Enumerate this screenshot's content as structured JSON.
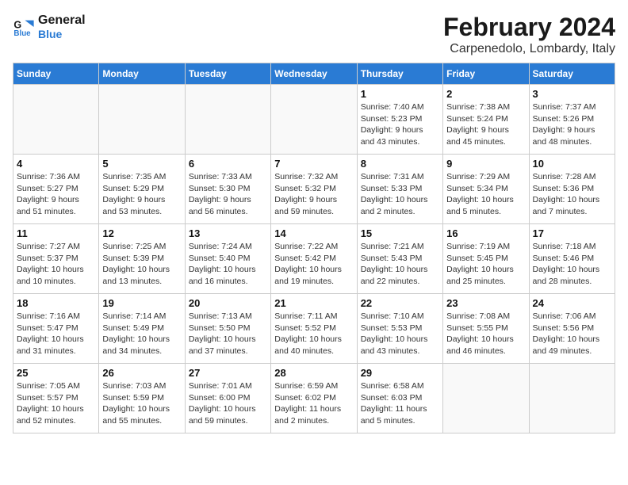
{
  "header": {
    "logo_line1": "General",
    "logo_line2": "Blue",
    "title": "February 2024",
    "subtitle": "Carpenedolo, Lombardy, Italy"
  },
  "weekdays": [
    "Sunday",
    "Monday",
    "Tuesday",
    "Wednesday",
    "Thursday",
    "Friday",
    "Saturday"
  ],
  "weeks": [
    [
      {
        "day": "",
        "info": ""
      },
      {
        "day": "",
        "info": ""
      },
      {
        "day": "",
        "info": ""
      },
      {
        "day": "",
        "info": ""
      },
      {
        "day": "1",
        "info": "Sunrise: 7:40 AM\nSunset: 5:23 PM\nDaylight: 9 hours\nand 43 minutes."
      },
      {
        "day": "2",
        "info": "Sunrise: 7:38 AM\nSunset: 5:24 PM\nDaylight: 9 hours\nand 45 minutes."
      },
      {
        "day": "3",
        "info": "Sunrise: 7:37 AM\nSunset: 5:26 PM\nDaylight: 9 hours\nand 48 minutes."
      }
    ],
    [
      {
        "day": "4",
        "info": "Sunrise: 7:36 AM\nSunset: 5:27 PM\nDaylight: 9 hours\nand 51 minutes."
      },
      {
        "day": "5",
        "info": "Sunrise: 7:35 AM\nSunset: 5:29 PM\nDaylight: 9 hours\nand 53 minutes."
      },
      {
        "day": "6",
        "info": "Sunrise: 7:33 AM\nSunset: 5:30 PM\nDaylight: 9 hours\nand 56 minutes."
      },
      {
        "day": "7",
        "info": "Sunrise: 7:32 AM\nSunset: 5:32 PM\nDaylight: 9 hours\nand 59 minutes."
      },
      {
        "day": "8",
        "info": "Sunrise: 7:31 AM\nSunset: 5:33 PM\nDaylight: 10 hours\nand 2 minutes."
      },
      {
        "day": "9",
        "info": "Sunrise: 7:29 AM\nSunset: 5:34 PM\nDaylight: 10 hours\nand 5 minutes."
      },
      {
        "day": "10",
        "info": "Sunrise: 7:28 AM\nSunset: 5:36 PM\nDaylight: 10 hours\nand 7 minutes."
      }
    ],
    [
      {
        "day": "11",
        "info": "Sunrise: 7:27 AM\nSunset: 5:37 PM\nDaylight: 10 hours\nand 10 minutes."
      },
      {
        "day": "12",
        "info": "Sunrise: 7:25 AM\nSunset: 5:39 PM\nDaylight: 10 hours\nand 13 minutes."
      },
      {
        "day": "13",
        "info": "Sunrise: 7:24 AM\nSunset: 5:40 PM\nDaylight: 10 hours\nand 16 minutes."
      },
      {
        "day": "14",
        "info": "Sunrise: 7:22 AM\nSunset: 5:42 PM\nDaylight: 10 hours\nand 19 minutes."
      },
      {
        "day": "15",
        "info": "Sunrise: 7:21 AM\nSunset: 5:43 PM\nDaylight: 10 hours\nand 22 minutes."
      },
      {
        "day": "16",
        "info": "Sunrise: 7:19 AM\nSunset: 5:45 PM\nDaylight: 10 hours\nand 25 minutes."
      },
      {
        "day": "17",
        "info": "Sunrise: 7:18 AM\nSunset: 5:46 PM\nDaylight: 10 hours\nand 28 minutes."
      }
    ],
    [
      {
        "day": "18",
        "info": "Sunrise: 7:16 AM\nSunset: 5:47 PM\nDaylight: 10 hours\nand 31 minutes."
      },
      {
        "day": "19",
        "info": "Sunrise: 7:14 AM\nSunset: 5:49 PM\nDaylight: 10 hours\nand 34 minutes."
      },
      {
        "day": "20",
        "info": "Sunrise: 7:13 AM\nSunset: 5:50 PM\nDaylight: 10 hours\nand 37 minutes."
      },
      {
        "day": "21",
        "info": "Sunrise: 7:11 AM\nSunset: 5:52 PM\nDaylight: 10 hours\nand 40 minutes."
      },
      {
        "day": "22",
        "info": "Sunrise: 7:10 AM\nSunset: 5:53 PM\nDaylight: 10 hours\nand 43 minutes."
      },
      {
        "day": "23",
        "info": "Sunrise: 7:08 AM\nSunset: 5:55 PM\nDaylight: 10 hours\nand 46 minutes."
      },
      {
        "day": "24",
        "info": "Sunrise: 7:06 AM\nSunset: 5:56 PM\nDaylight: 10 hours\nand 49 minutes."
      }
    ],
    [
      {
        "day": "25",
        "info": "Sunrise: 7:05 AM\nSunset: 5:57 PM\nDaylight: 10 hours\nand 52 minutes."
      },
      {
        "day": "26",
        "info": "Sunrise: 7:03 AM\nSunset: 5:59 PM\nDaylight: 10 hours\nand 55 minutes."
      },
      {
        "day": "27",
        "info": "Sunrise: 7:01 AM\nSunset: 6:00 PM\nDaylight: 10 hours\nand 59 minutes."
      },
      {
        "day": "28",
        "info": "Sunrise: 6:59 AM\nSunset: 6:02 PM\nDaylight: 11 hours\nand 2 minutes."
      },
      {
        "day": "29",
        "info": "Sunrise: 6:58 AM\nSunset: 6:03 PM\nDaylight: 11 hours\nand 5 minutes."
      },
      {
        "day": "",
        "info": ""
      },
      {
        "day": "",
        "info": ""
      }
    ]
  ]
}
